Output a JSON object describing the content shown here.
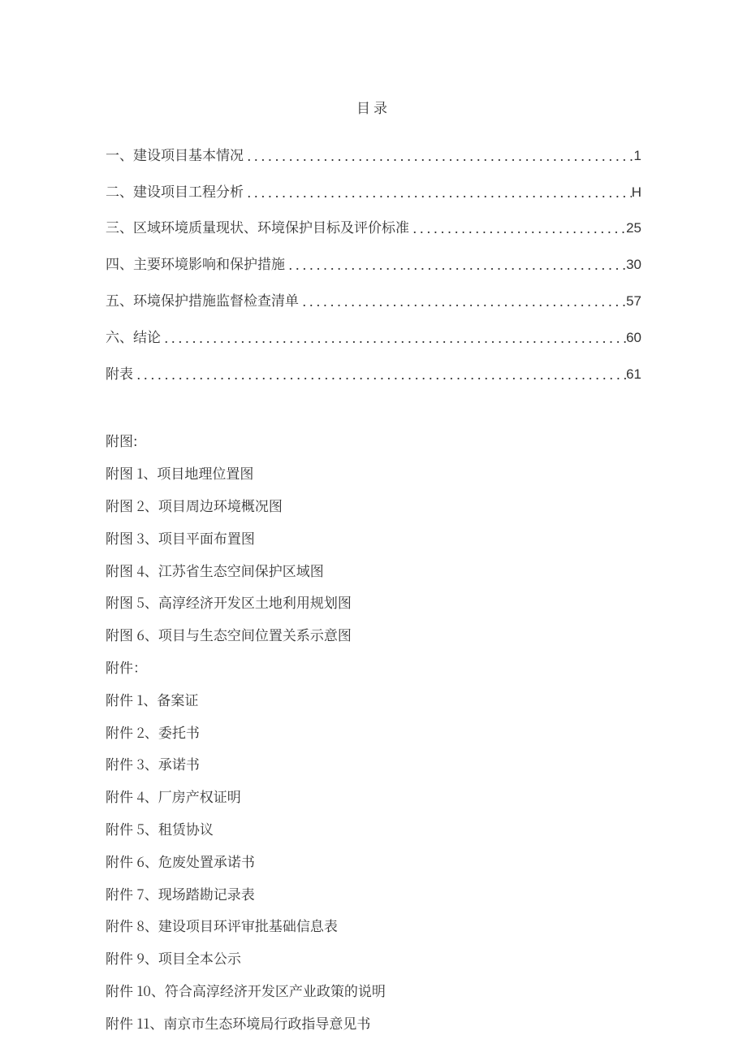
{
  "title": "目录",
  "toc": [
    {
      "label": "一、建设项目基本情况",
      "page": "1"
    },
    {
      "label": "二、建设项目工程分析",
      "page": "H"
    },
    {
      "label": "三、区域环境质量现状、环境保护目标及评价标准",
      "page": "25"
    },
    {
      "label": "四、主要环境影响和保护措施",
      "page": "30"
    },
    {
      "label": "五、环境保护措施监督检查清单",
      "page": "57"
    },
    {
      "label": "六、结论",
      "page": "60"
    },
    {
      "label": "附表",
      "page": "61"
    }
  ],
  "figures_heading": "附图:",
  "figures": [
    {
      "num": "1",
      "text": "项目地理位置图"
    },
    {
      "num": "2",
      "text": "项目周边环境概况图"
    },
    {
      "num": "3",
      "text": "项目平面布置图"
    },
    {
      "num": "4",
      "text": "江苏省生态空间保护区域图"
    },
    {
      "num": "5",
      "text": "高淳经济开发区土地利用规划图"
    },
    {
      "num": "6",
      "text": "项目与生态空间位置关系示意图"
    }
  ],
  "attachments_heading": "附件：",
  "attachments": [
    {
      "num": "1",
      "text": "备案证"
    },
    {
      "num": "2",
      "text": "委托书"
    },
    {
      "num": "3",
      "text": "承诺书"
    },
    {
      "num": "4",
      "text": "厂房产权证明"
    },
    {
      "num": "5",
      "text": "租赁协议"
    },
    {
      "num": "6",
      "text": "危废处置承诺书"
    },
    {
      "num": "7",
      "text": "现场踏勘记录表"
    },
    {
      "num": "8",
      "text": "建设项目环评审批基础信息表"
    },
    {
      "num": "9",
      "text": "项目全本公示"
    },
    {
      "num": "10",
      "text": "符合高淳经济开发区产业政策的说明"
    },
    {
      "num": "11",
      "text": "南京市生态环境局行政指导意见书"
    }
  ],
  "figure_prefix": "附图",
  "attachment_prefix": "附件",
  "sep": "、"
}
